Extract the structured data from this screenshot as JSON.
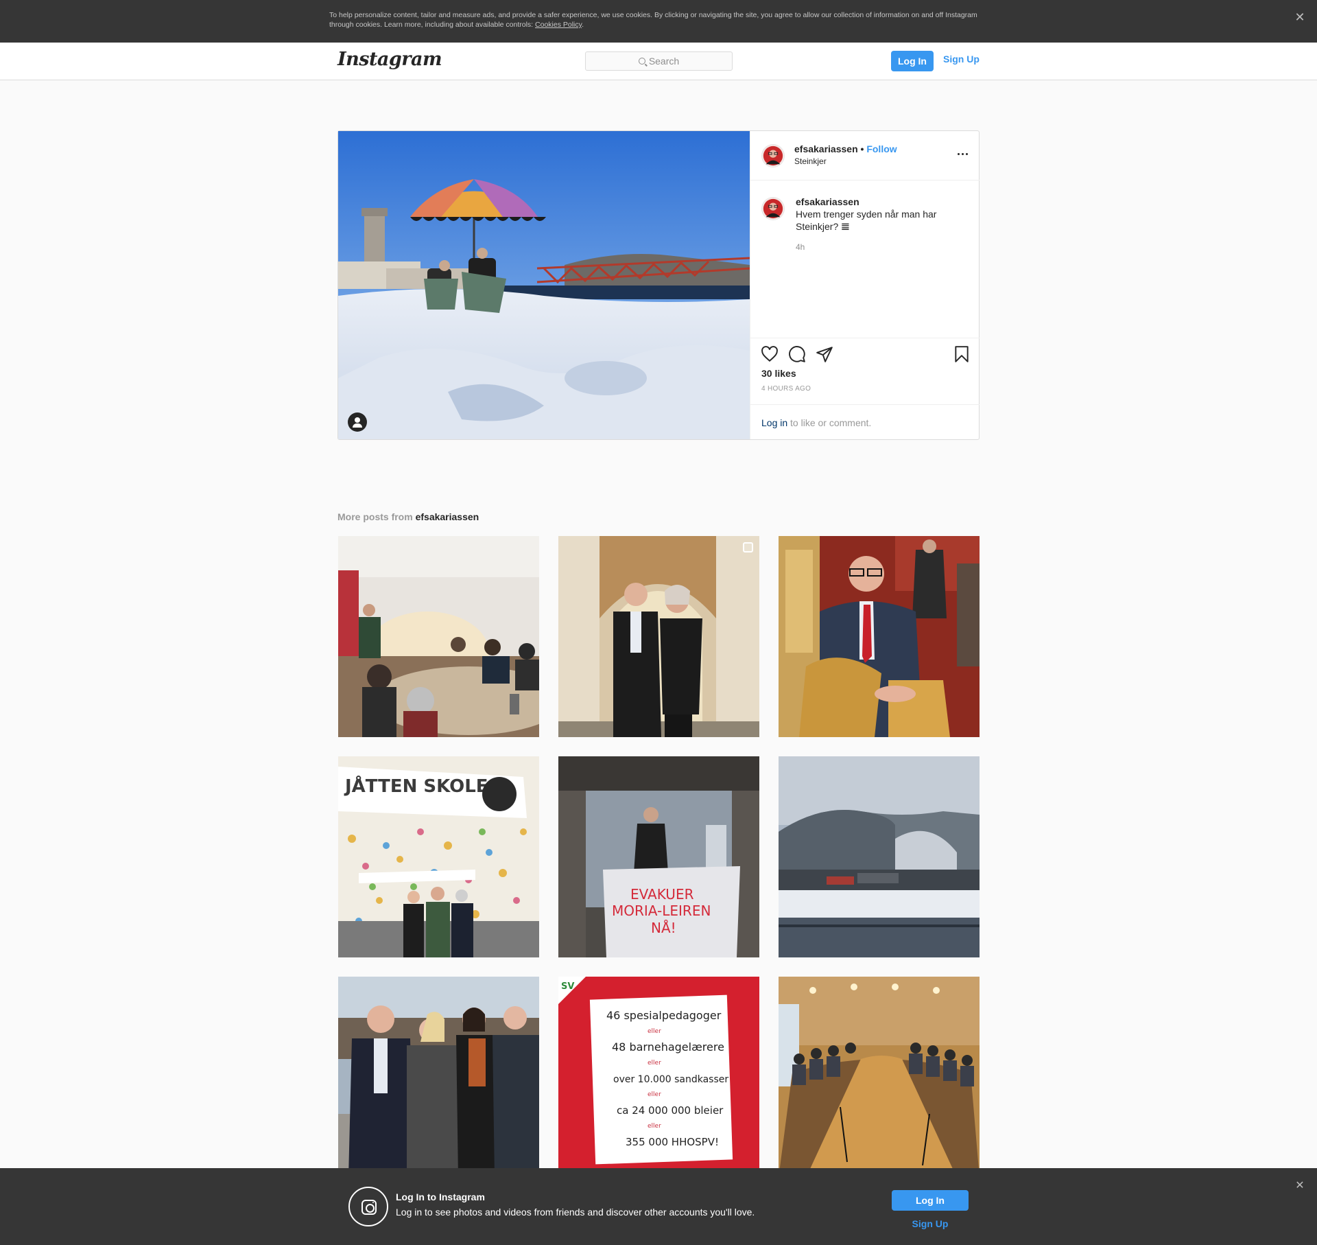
{
  "cookie_banner": {
    "text": "To help personalize content, tailor and measure ads, and provide a safer experience, we use cookies. By clicking or navigating the site, you agree to allow our collection of information on and off Instagram through cookies. Learn more, including about available controls: ",
    "link": "Cookies Policy",
    "close": "✕"
  },
  "header": {
    "logo": "Instagram",
    "search_placeholder": "Search",
    "login": "Log In",
    "signup": "Sign Up"
  },
  "post": {
    "username": "efsakariassen",
    "dot": "•",
    "follow": "Follow",
    "location": "Steinkjer",
    "caption_user": "efsakariassen",
    "caption": "Hvem trenger syden når man har Steinkjer? 𝌆",
    "caption_time": "4h",
    "likes": "30 likes",
    "posted": "4 HOURS AGO",
    "comment_login": "Log in",
    "comment_rest": " to like or comment."
  },
  "more_posts": {
    "prefix": "More posts from ",
    "user": "efsakariassen"
  },
  "login_bar": {
    "title": "Log In to Instagram",
    "text": "Log in to see photos and videos from friends and discover other accounts you'll love.",
    "login": "Log In",
    "signup": "Sign Up",
    "close": "✕"
  },
  "colors": {
    "accent": "#3897f0",
    "dark_bar": "#363636",
    "border": "#dbdbdb"
  },
  "icons": [
    "search-icon",
    "more-options-icon",
    "heart-icon",
    "comment-icon",
    "share-icon",
    "bookmark-icon",
    "user-tag-icon",
    "instagram-icon",
    "close-icon",
    "multiple-photos-icon"
  ]
}
